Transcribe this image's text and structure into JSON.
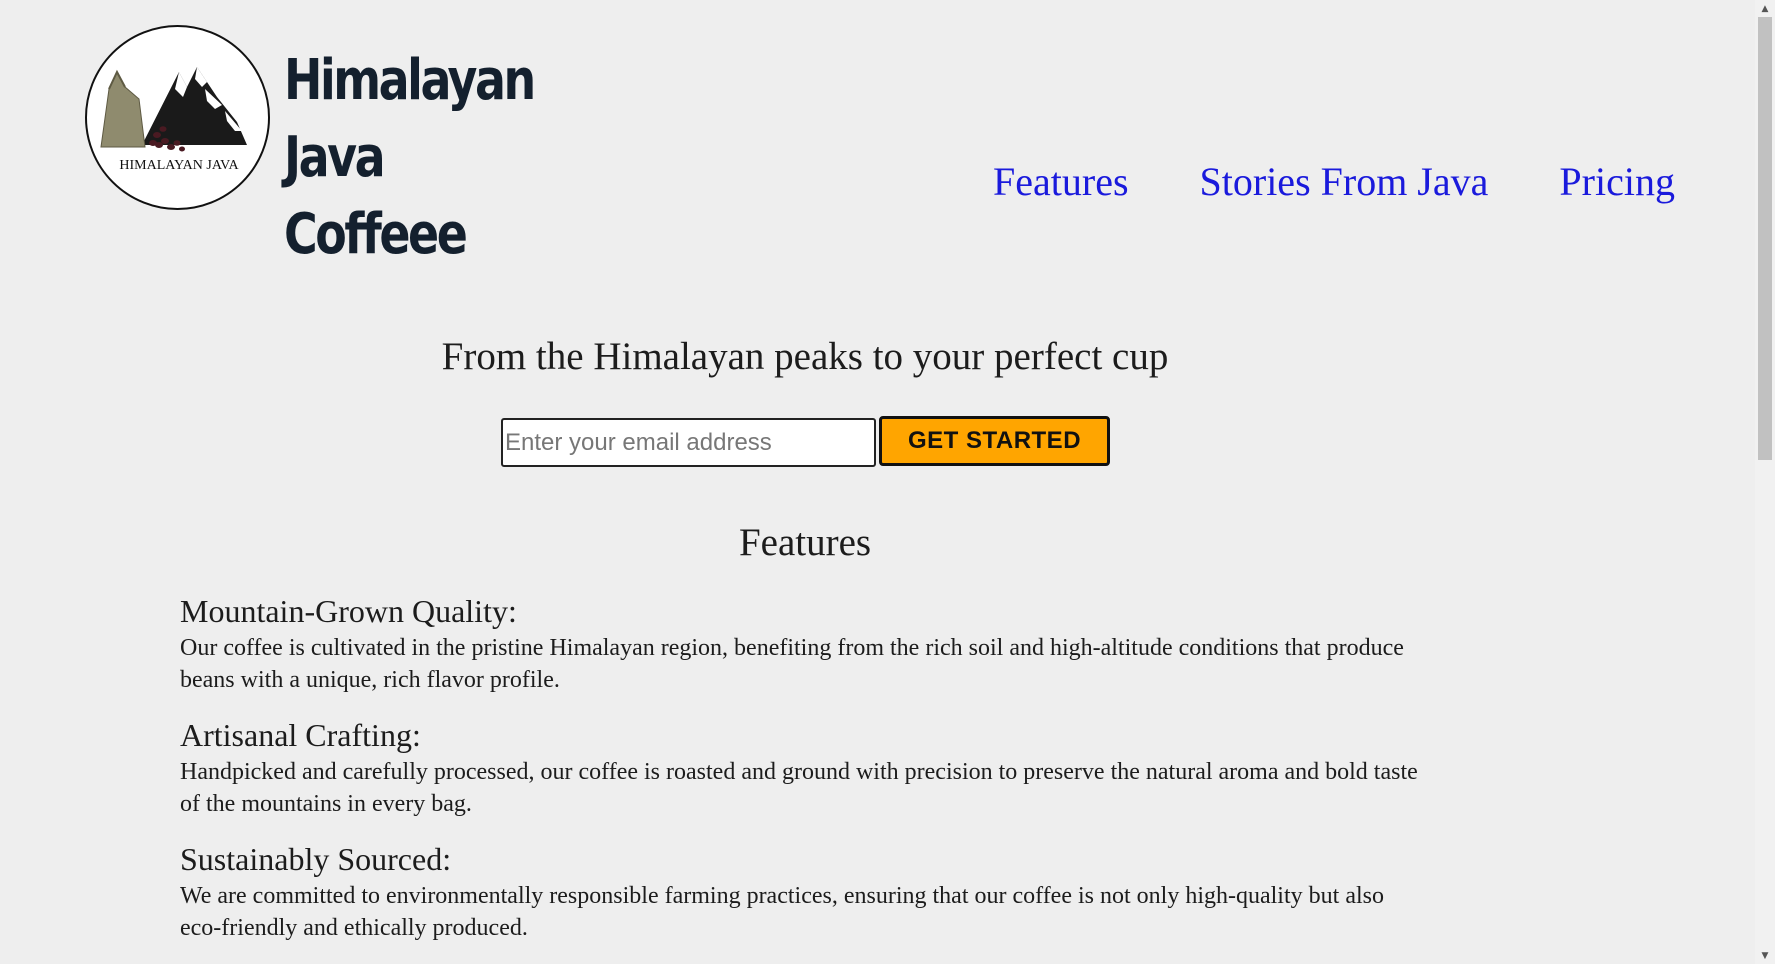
{
  "header": {
    "logo_text": "HIMALAYAN JAVA",
    "brand_title": "Himalayan Java Coffeee",
    "brand_line1": "Himalayan Java",
    "brand_line2": "Coffeee",
    "nav": [
      {
        "label": "Features"
      },
      {
        "label": "Stories From Java"
      },
      {
        "label": "Pricing"
      }
    ]
  },
  "hero": {
    "title": "From the Himalayan peaks to your perfect cup",
    "email_placeholder": "Enter your email address",
    "email_value": "",
    "cta_label": "GET STARTED"
  },
  "features": {
    "heading": "Features",
    "items": [
      {
        "title": "Mountain-Grown Quality:",
        "text": "Our coffee is cultivated in the pristine Himalayan region, benefiting from the rich soil and high-altitude conditions that produce beans with a unique, rich flavor profile."
      },
      {
        "title": "Artisanal Crafting:",
        "text": "Handpicked and carefully processed, our coffee is roasted and ground with precision to preserve the natural aroma and bold taste of the mountains in every bag."
      },
      {
        "title": "Sustainably Sourced:",
        "text": "We are committed to environmentally responsible farming practices, ensuring that our coffee is not only high-quality but also eco-friendly and ethically produced."
      }
    ]
  },
  "colors": {
    "background": "#eeeeee",
    "nav_link": "#1a1adc",
    "cta_background": "#ffa500",
    "brand_title": "#14202e"
  },
  "icons": {
    "logo": "mountain-coffee-sack-logo",
    "scroll_up": "scroll-up-arrow-icon",
    "scroll_down": "scroll-down-arrow-icon"
  }
}
